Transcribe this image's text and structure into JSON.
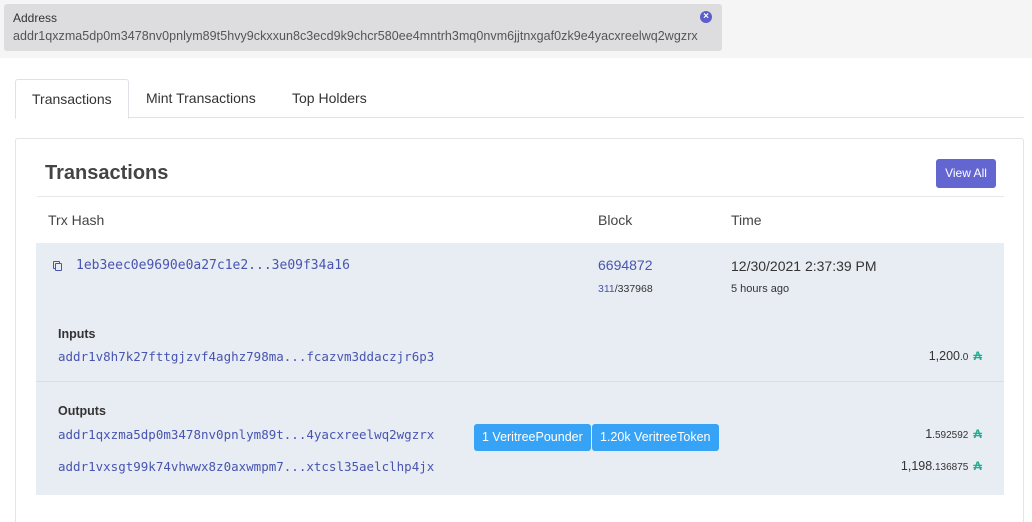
{
  "address_filter": {
    "label": "Address",
    "value": "addr1qxzma5dp0m3478nv0pnlym89t5hvy9ckxxun8c3ecd9k9chcr580ee4mntrh3mq0nvm6jjtnxgaf0zk9e4yacxreelwq2wgzrx",
    "close_icon": "×"
  },
  "tabs": [
    {
      "label": "Transactions",
      "active": true
    },
    {
      "label": "Mint Transactions",
      "active": false
    },
    {
      "label": "Top Holders",
      "active": false
    }
  ],
  "card": {
    "title": "Transactions",
    "view_all_label": "View All",
    "columns": {
      "hash": "Trx Hash",
      "block": "Block",
      "time": "Time"
    }
  },
  "transaction": {
    "hash": "1eb3eec0e9690e0a27c1e2...3e09f34a16",
    "block": "6694872",
    "slot_current": "311",
    "slot_total": "/337968",
    "time": "12/30/2021 2:37:39 PM",
    "time_ago": "5 hours ago",
    "inputs_label": "Inputs",
    "outputs_label": "Outputs",
    "inputs": [
      {
        "address": "addr1v8h7k27fttgjzvf4aghz798ma...fcazvm3ddaczjr6p3",
        "amount_int": "1,200",
        "amount_dec": ".0"
      }
    ],
    "outputs": [
      {
        "address": "addr1qxzma5dp0m3478nv0pnlym89t...4yacxreelwq2wgzrx",
        "tokens": [
          "1 VeritreePounder",
          "1.20k VeritreeToken"
        ],
        "amount_int": "1",
        "amount_dec": ".592592"
      },
      {
        "address": "addr1vxsgt99k74vhwwx8z0axwmpm7...xtcsl35aelclhp4jx",
        "amount_int": "1,198",
        "amount_dec": ".136875"
      }
    ],
    "currency_symbol": "₳"
  },
  "colors": {
    "accent": "#6366d1",
    "link": "#4855b0",
    "token_badge": "#36a3f7",
    "ada": "#1fae8f"
  }
}
